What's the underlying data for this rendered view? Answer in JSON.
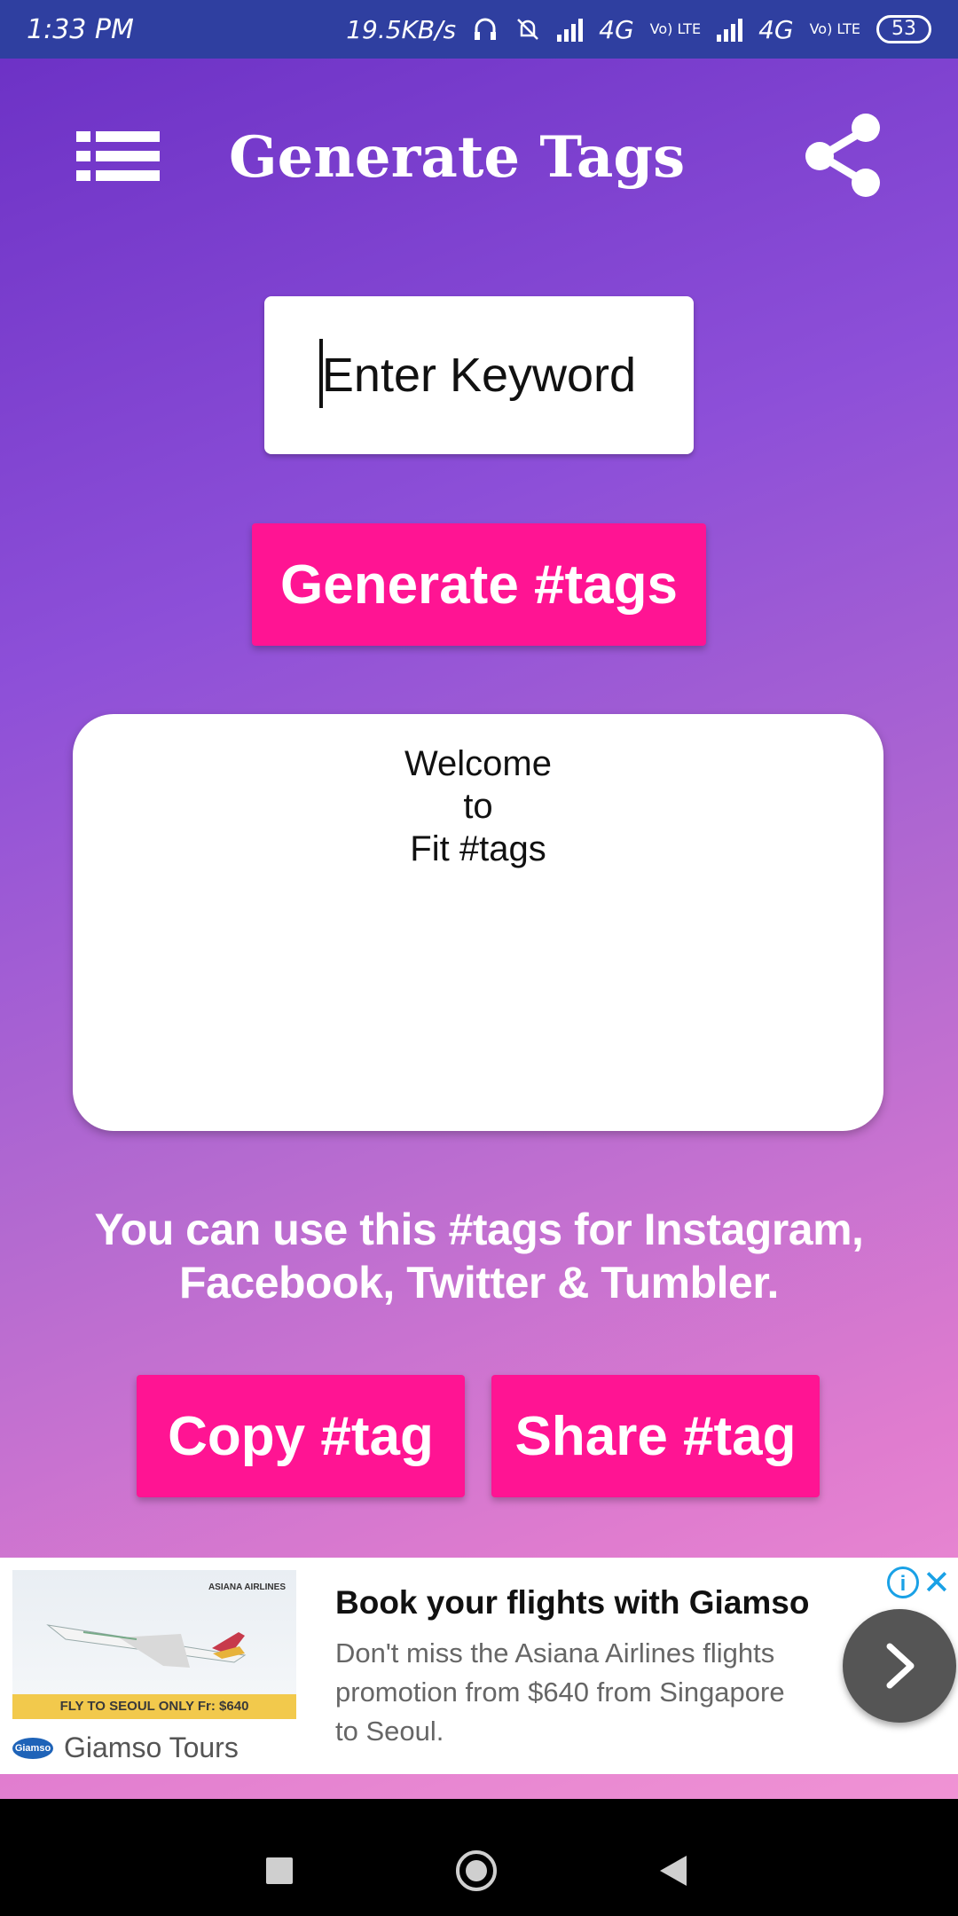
{
  "status_bar": {
    "time": "1:33 PM",
    "network_speed": "19.5KB/s",
    "network_type_1": "4G",
    "network_type_2": "4G",
    "lte_label": "Vo) LTE",
    "battery": "53"
  },
  "app_bar": {
    "title": "Generate Tags"
  },
  "keyword": {
    "placeholder": "Enter Keyword",
    "value": ""
  },
  "buttons": {
    "generate": "Generate #tags",
    "copy": "Copy #tag",
    "share": "Share #tag"
  },
  "result": {
    "line1": "Welcome",
    "line2": "to",
    "line3": "Fit #tags"
  },
  "info_text": "You can use this #tags for Instagram, Facebook, Twitter & Tumbler.",
  "ad": {
    "title": "Book your flights with Giamso",
    "description": "Don't miss the Asiana Airlines flights promotion from $640 from Singapore to Seoul.",
    "image_banner": "FLY TO SEOUL ONLY Fr: $640",
    "image_airline": "ASIANA AIRLINES",
    "advertiser": "Giamso Tours",
    "logo_text": "Giamso"
  },
  "colors": {
    "accent_pink": "#ff1493",
    "status_bar": "#2f3fa0",
    "ad_link": "#1aa1e6"
  }
}
